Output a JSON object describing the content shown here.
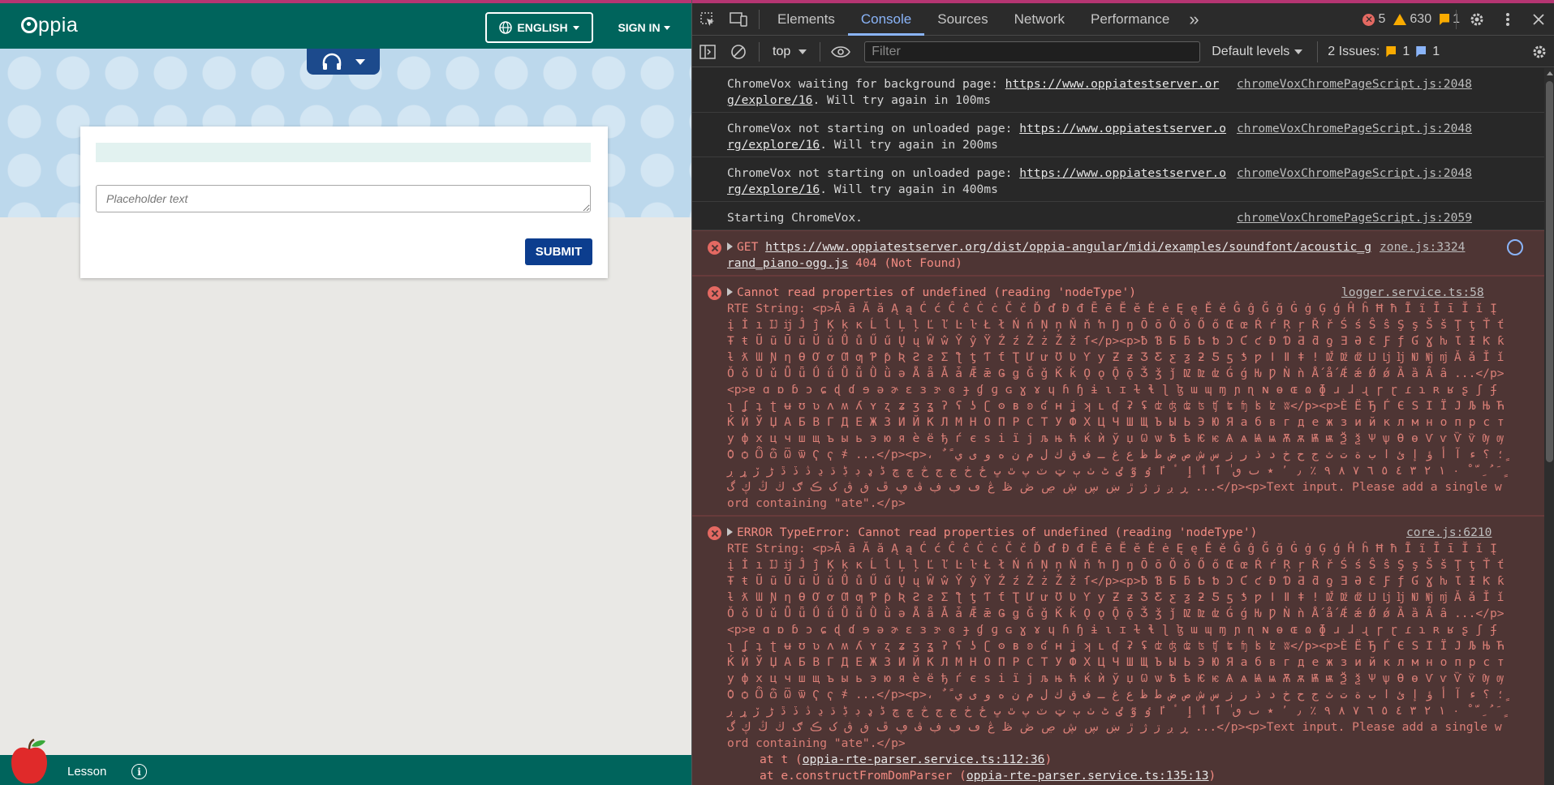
{
  "app": {
    "logo_text": "ppia",
    "language_label": "ENGLISH",
    "signin_label": "SIGN IN",
    "answer_placeholder": "Placeholder text",
    "submit_label": "SUBMIT",
    "footer_lesson_label": "Lesson",
    "info_label": "i",
    "colors": {
      "nav": "#00645c",
      "banner": "#bcd8ec",
      "submit": "#0c3d8e",
      "audio": "#1c4a8c"
    }
  },
  "devtools": {
    "tabs": [
      "Elements",
      "Console",
      "Sources",
      "Network",
      "Performance"
    ],
    "active_tab": "Console",
    "more_tabs": "»",
    "error_count": "5",
    "warning_count": "630",
    "issue_count": "1",
    "context": "top",
    "filter_placeholder": "Filter",
    "levels_label": "Default levels",
    "issues_label": "2 Issues:",
    "issues_warn": "1",
    "issues_info": "1",
    "messages": [
      {
        "pre": "ChromeVox waiting for background page: ",
        "link": "https://www.oppiatestserver.org/explore/16",
        "post": ". Will try again in 100ms",
        "source": "chromeVoxChromePageScript.js:2048"
      },
      {
        "pre": "ChromeVox not starting on unloaded page: ",
        "link": "https://www.oppiatestserver.org/explore/16",
        "post": ". Will try again in 200ms",
        "source": "chromeVoxChromePageScript.js:2048"
      },
      {
        "pre": "ChromeVox not starting on unloaded page: ",
        "link": "https://www.oppiatestserver.org/explore/16",
        "post": ". Will try again in 400ms",
        "source": "chromeVoxChromePageScript.js:2048"
      },
      {
        "pre": "Starting ChromeVox.",
        "link": "",
        "post": "",
        "source": "chromeVoxChromePageScript.js:2059"
      }
    ],
    "get_error": {
      "method": "GET",
      "url": "https://www.oppiatestserver.org/dist/oppia-angular/midi/examples/soundfont/acoustic_grand_piano-ogg.js",
      "status": "404 (Not Found)",
      "source": "zone.js:3324"
    },
    "rte_error_1": {
      "title": "Cannot read properties of undefined (reading 'nodeType')",
      "source": "logger.service.ts:58"
    },
    "rte_error_2": {
      "title": "ERROR TypeError: Cannot read properties of undefined (reading 'nodeType')",
      "source": "core.js:6210",
      "stack": [
        {
          "pre": "at t (",
          "link": "oppia-rte-parser.service.ts:112:36",
          "post": ")"
        },
        {
          "pre": "at e.constructFromDomParser (",
          "link": "oppia-rte-parser.service.ts:135:13",
          "post": ")"
        }
      ]
    },
    "rte_string": "RTE String: <p>Ā ā Ă ă Ą ą Ć ć Ĉ ĉ Ċ ċ Č č Ď ď Đ đ Ē ē Ĕ ĕ Ė ė Ę ę Ě ě Ĝ ĝ Ğ ğ Ġ ġ Ģ ģ Ĥ ĥ Ħ ħ Ĩ ĩ Ī ī Ĭ ĭ Į į İ ı Ĳ ĳ Ĵ ĵ Ķ ķ ĸ Ĺ ĺ Ļ ļ Ľ ľ Ŀ ŀ Ł ł Ń ń Ņ ņ Ň ň ŉ Ŋ ŋ Ō ō Ŏ ŏ Ő ő Œ œ Ŕ ŕ Ŗ ŗ Ř ř Ś ś Ŝ ŝ Ş ş Š š Ţ ţ Ť ť Ŧ ŧ Ũ ũ Ū ū Ŭ ŭ Ů ů Ű ű Ų ų Ŵ ŵ Ŷ ŷ Ÿ Ź ź Ż ż Ž ž ſ</p><p>ƀ Ɓ Ƃ ƃ Ƅ ƅ Ɔ Ƈ ƈ Ɖ Ɗ Ƌ ƌ ƍ Ǝ Ə Ɛ Ƒ ƒ Ɠ Ɣ ƕ Ɩ Ɨ Ƙ ƙ ƚ ƛ Ɯ Ɲ ƞ Ɵ Ơ ơ Ƣ ƣ Ƥ ƥ Ʀ Ƨ ƨ Ʃ ƪ ƫ Ƭ ƭ Ʈ Ư ư Ʊ Ʋ Ƴ ƴ Ƶ ƶ Ʒ Ƹ ƹ ƺ ƻ Ƽ ƽ ƾ ƿ ǀ ǁ ǂ ǃ Ǆ ǅ ǆ Ǉ ǈ ǉ Ǌ ǋ ǌ Ǎ ǎ Ǐ ǐ Ǒ ǒ Ǔ ǔ Ǖ ǖ Ǘ ǘ Ǚ ǚ Ǜ ǜ ǝ Ǟ ǟ Ǡ ǡ Ǣ ǣ Ǥ ǥ Ǧ ǧ Ǩ ǩ Ǫ ǫ Ǭ ǭ Ǯ ǯ ǰ Ǳ ǲ ǳ Ǵ ǵ Ƕ Ƿ Ǹ ǹ Ǻ ǻ Ǽ ǽ Ǿ ǿ Ȁ ȁ Ȃ ȃ ...</p><p>ɐ ɑ ɒ ɓ ɔ ɕ ɖ ɗ ɘ ə ɚ ɛ ɜ ɝ ɞ ɟ ɠ ɡ ɢ ɣ ɤ ɥ ɦ ɧ ɨ ɩ ɪ ɫ ɬ ɭ ɮ ɯ ɰ ɱ ɲ ɳ ɴ ɵ ɶ ɷ ɸ ɹ ɺ ɻ ɼ ɽ ɾ ɿ ʀ ʁ ʂ ʃ ʄ ʅ ʆ ʇ ʈ ʉ ʊ ʋ ʌ ʍ ʎ ʏ ʐ ʑ ʒ ʓ ʔ ʕ ʖ ʗ ʘ ʙ ʚ ʛ ʜ ʝ ʞ ʟ ʠ ʡ ʢ ʣ ʤ ʥ ʦ ʧ ʨ ʩ ʪ ʫ ʬ</p><p>Ѐ Ё Ђ Ѓ Є Ѕ І Ї Ј Љ Њ Ћ Ќ Ѝ Ў Џ А Б В Г Д Е Ж З И Й К Л М Н О П Р С Т У Ф Х Ц Ч Ш Щ Ъ Ы Ь Э Ю Я а б в г д е ж з и й к л м н о п р с т у ф х ц ч ш щ ъ ы ь э ю я ѐ ё ђ ѓ є ѕ і ї ј љ њ ћ ќ ѝ ў џ Ѡ ѡ Ѣ ѣ Ѥ ѥ Ѧ ѧ Ѩ ѩ Ѫ ѫ Ѭ ѭ Ѯ ѯ Ѱ ѱ Ѳ ѳ Ѵ ѵ Ѷ ѷ Ѹ ѹ Ѻ ѻ Ѽ ѽ Ѿ ѿ Ҁ ҁ ҂ ...</p><p>، ؛ ؟ ء آ أ ؤ إ ئ ا ب ة ت ث ج ح خ د ذ ر ز س ش ص ض ط ظ ع غ ـ ف ق ك ل م ن ه و ى ي ً ٌ ٍ َ ُ ِ ّ ْ ٠ ١ ٢ ٣ ٤ ٥ ٦ ٧ ٨ ٩ ٪ ٫ ٬ ٭ ٮ ٯ ٰ ٱ ٲ ٳ ٴ ٵ ٶ ٷ ٸ ٹ ٺ ٻ ټ ٽ پ ٿ ڀ ځ ڂ ڃ ڄ څ چ ڇ ڈ ډ ڊ ڋ ڌ ڍ ڎ ڏ ڐ ڑ ڒ ړ ڔ ڕ ږ ڗ ژ ڙ ښ ڛ ڜ ڝ ڞ ڟ ڠ ڡ ڢ ڣ ڤ ڥ ڦ ڧ ڨ ک ڪ ګ ڬ ڭ ڮ گ ...</p><p>Text input. Please add a single word containing \"ate\".</p>"
  }
}
